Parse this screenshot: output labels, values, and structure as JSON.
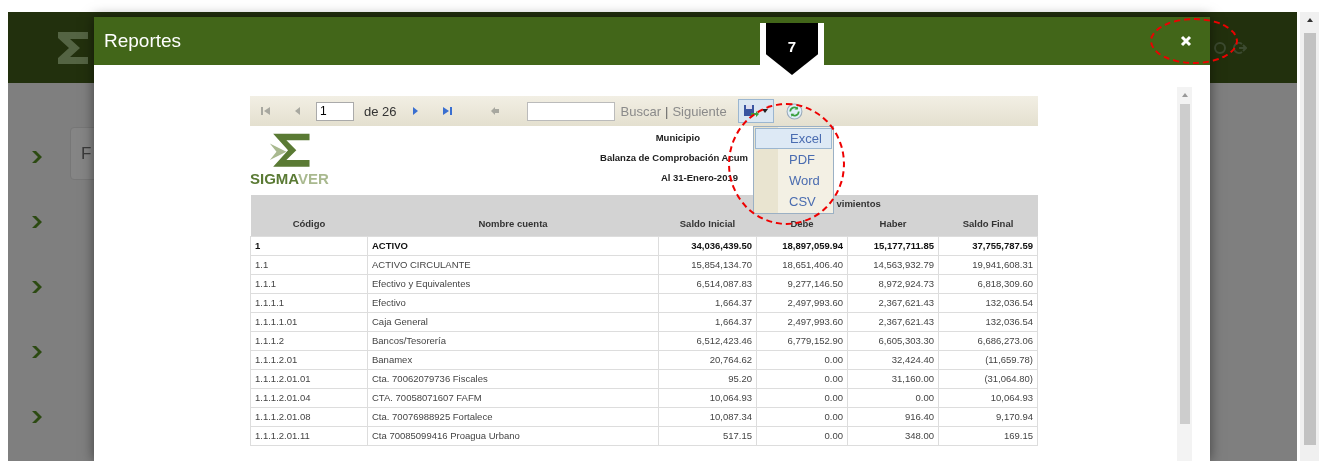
{
  "background_page": {
    "card_text": "F"
  },
  "dialog": {
    "title": "Reportes"
  },
  "toolbar": {
    "nav": [
      {
        "kind": "first",
        "disabled": true
      },
      {
        "kind": "prev",
        "disabled": true
      },
      {
        "kind": "page",
        "value": "1"
      },
      {
        "kind": "count",
        "text": "de 26"
      },
      {
        "kind": "next",
        "disabled": false
      },
      {
        "kind": "last",
        "disabled": false
      },
      {
        "kind": "back",
        "disabled": true
      },
      {
        "kind": "search"
      },
      {
        "kind": "find",
        "text": "Buscar",
        "disabled": true
      },
      {
        "kind": "sep",
        "text": "|"
      },
      {
        "kind": "find",
        "text": "Siguiente",
        "disabled": true
      },
      {
        "kind": "export",
        "expanded": true
      },
      {
        "kind": "refresh"
      }
    ]
  },
  "export_menu": {
    "items": [
      {
        "label": "Excel",
        "selected": true
      },
      {
        "label": "PDF",
        "selected": false
      },
      {
        "label": "Word",
        "selected": false
      },
      {
        "label": "CSV",
        "selected": false
      }
    ]
  },
  "report": {
    "logo": "SIGMA",
    "logo_suffix": "VER",
    "lines": [
      "Municipio",
      "Balanza de Comprobación Acum",
      "Al 31-Enero-2019"
    ]
  },
  "table": {
    "group_header": "vimientos",
    "columns": [
      "Código",
      "Nombre cuenta",
      "Saldo Inicial",
      "Debe",
      "Haber",
      "Saldo Final"
    ],
    "rows": [
      {
        "bold": true,
        "cells": [
          "1",
          "ACTIVO",
          "34,036,439.50",
          "18,897,059.94",
          "15,177,711.85",
          "37,755,787.59"
        ]
      },
      {
        "bold": false,
        "cells": [
          "1.1",
          "ACTIVO CIRCULANTE",
          "15,854,134.70",
          "18,651,406.40",
          "14,563,932.79",
          "19,941,608.31"
        ]
      },
      {
        "bold": false,
        "cells": [
          "1.1.1",
          "Efectivo y Equivalentes",
          "6,514,087.83",
          "9,277,146.50",
          "8,972,924.73",
          "6,818,309.60"
        ]
      },
      {
        "bold": false,
        "cells": [
          "1.1.1.1",
          "Efectivo",
          "1,664.37",
          "2,497,993.60",
          "2,367,621.43",
          "132,036.54"
        ]
      },
      {
        "bold": false,
        "cells": [
          "1.1.1.1.01",
          "Caja General",
          "1,664.37",
          "2,497,993.60",
          "2,367,621.43",
          "132,036.54"
        ]
      },
      {
        "bold": false,
        "cells": [
          "1.1.1.2",
          "Bancos/Tesorería",
          "6,512,423.46",
          "6,779,152.90",
          "6,605,303.30",
          "6,686,273.06"
        ]
      },
      {
        "bold": false,
        "cells": [
          "1.1.1.2.01",
          "Banamex",
          "20,764.62",
          "0.00",
          "32,424.40",
          "(11,659.78)"
        ]
      },
      {
        "bold": false,
        "cells": [
          "1.1.1.2.01.01",
          "Cta. 70062079736 Fiscales",
          "95.20",
          "0.00",
          "31,160.00",
          "(31,064.80)"
        ]
      },
      {
        "bold": false,
        "cells": [
          "1.1.1.2.01.04",
          "CTA. 70058071607 FAFM",
          "10,064.93",
          "0.00",
          "0.00",
          "10,064.93"
        ]
      },
      {
        "bold": false,
        "cells": [
          "1.1.1.2.01.08",
          "Cta. 70076988925 Fortalece",
          "10,087.34",
          "0.00",
          "916.40",
          "9,170.94"
        ]
      },
      {
        "bold": false,
        "cells": [
          "1.1.1.2.01.11",
          "Cta 70085099416 Proagua Urbano",
          "517.15",
          "0.00",
          "348.00",
          "169.15"
        ]
      }
    ]
  },
  "annotation": {
    "step": "7"
  }
}
